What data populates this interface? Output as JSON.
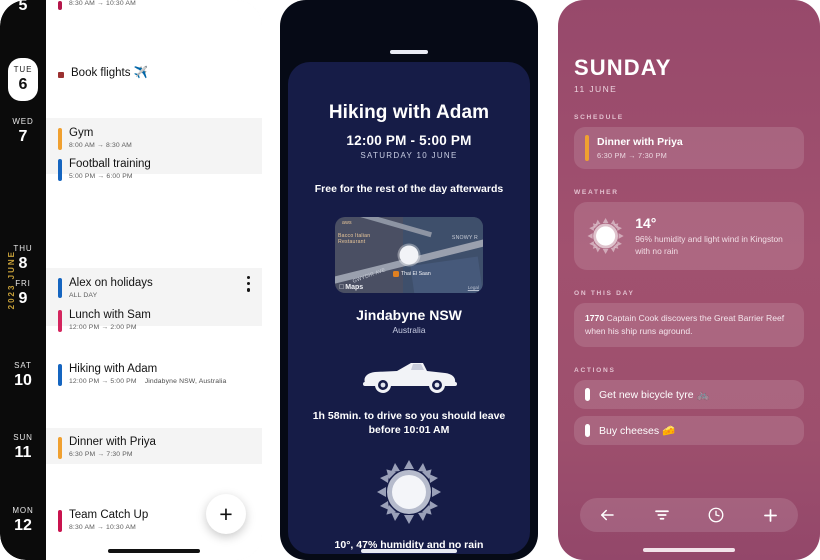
{
  "panel_calendar": {
    "rail_month_label": "2023 JUNE",
    "days": [
      {
        "dow": "",
        "num": "5",
        "selected": false
      },
      {
        "dow": "TUE",
        "num": "6",
        "selected": true
      },
      {
        "dow": "WED",
        "num": "7",
        "selected": false
      },
      {
        "dow": "THU",
        "num": "8",
        "selected": false
      },
      {
        "dow": "FRI",
        "num": "9",
        "selected": false
      },
      {
        "dow": "SAT",
        "num": "10",
        "selected": false
      },
      {
        "dow": "SUN",
        "num": "11",
        "selected": false
      },
      {
        "dow": "MON",
        "num": "12",
        "selected": false
      }
    ],
    "groups": [
      {
        "events": [
          {
            "title": "",
            "meta": "8:30 AM → 10:30 AM",
            "color": "#b5174b",
            "marker": "bar"
          }
        ]
      },
      {
        "events": [
          {
            "title": "Book flights ✈️",
            "meta": "",
            "color": "#9b3030",
            "marker": "dot"
          }
        ]
      },
      {
        "events": [
          {
            "title": "Gym",
            "meta": "8:00 AM → 8:30 AM",
            "color": "#f0a030",
            "marker": "bar"
          },
          {
            "title": "Football training",
            "meta": "5:00 PM → 6:00 PM",
            "color": "#1565c0",
            "marker": "bar"
          }
        ]
      },
      {
        "events": [
          {
            "title": "Alex on holidays",
            "meta": "ALL DAY",
            "color": "#1565c0",
            "marker": "bar"
          },
          {
            "title": "Lunch with Sam",
            "meta": "12:00 PM → 2:00 PM",
            "color": "#d4255e",
            "marker": "bar"
          }
        ]
      },
      {
        "events": [
          {
            "title": "Hiking with Adam",
            "meta": "12:00 PM → 5:00 PM",
            "location": "Jindabyne NSW, Australia",
            "color": "#1565c0",
            "marker": "bar"
          }
        ]
      },
      {
        "events": [
          {
            "title": "Dinner with Priya",
            "meta": "6:30 PM → 7:30 PM",
            "color": "#f0a030",
            "marker": "bar"
          }
        ]
      },
      {
        "events": [
          {
            "title": "Team Catch Up",
            "meta": "8:30 AM → 10:30 AM",
            "color": "#c9134e",
            "marker": "bar"
          }
        ]
      }
    ],
    "add_button_label": "+",
    "overflow_menu_name": "more-options"
  },
  "panel_event": {
    "title": "Hiking with Adam",
    "time": "12:00 PM - 5:00 PM",
    "date": "SATURDAY 10 JUNE",
    "free_note": "Free for the rest of the day afterwards",
    "map": {
      "attribution": "Maps",
      "legal": "Legal",
      "labels": [
        "aws",
        "Bacco Italian Restaurant",
        "SNOWY R",
        "GWYDIR AVE"
      ],
      "poi": "Thai El Saan"
    },
    "place": "Jindabyne NSW",
    "country": "Australia",
    "drive_note": "1h 58min. to drive so you should leave before 10:01 AM",
    "weather_note": "10°, 47% humidity and no rain"
  },
  "panel_day": {
    "day_name": "SUNDAY",
    "date": "11 JUNE",
    "sections": {
      "schedule": "SCHEDULE",
      "weather": "WEATHER",
      "on_this_day": "ON THIS DAY",
      "actions": "ACTIONS"
    },
    "schedule_items": [
      {
        "title": "Dinner with Priya",
        "meta": "6:30 PM → 7:30 PM",
        "color": "#f0a030"
      }
    ],
    "weather": {
      "temperature": "14°",
      "description": "96% humidity and light wind in Kingston with no rain",
      "icon": "sun-icon"
    },
    "on_this_day": {
      "year": "1770",
      "text": " Captain Cook discovers the Great Barrier Reef when his ship runs aground."
    },
    "actions": [
      {
        "label": "Get new bicycle tyre 🚲"
      },
      {
        "label": "Buy cheeses 🧀"
      }
    ],
    "nav": [
      {
        "name": "back-icon"
      },
      {
        "name": "filter-icon"
      },
      {
        "name": "clock-icon"
      },
      {
        "name": "plus-icon"
      }
    ]
  },
  "colors": {
    "accent_pink": "#9d4f6d",
    "navy_card": "#161c47",
    "dark_frame": "#060a16",
    "rail_black": "#0b0b0b",
    "month_gold": "#c8a13a"
  }
}
